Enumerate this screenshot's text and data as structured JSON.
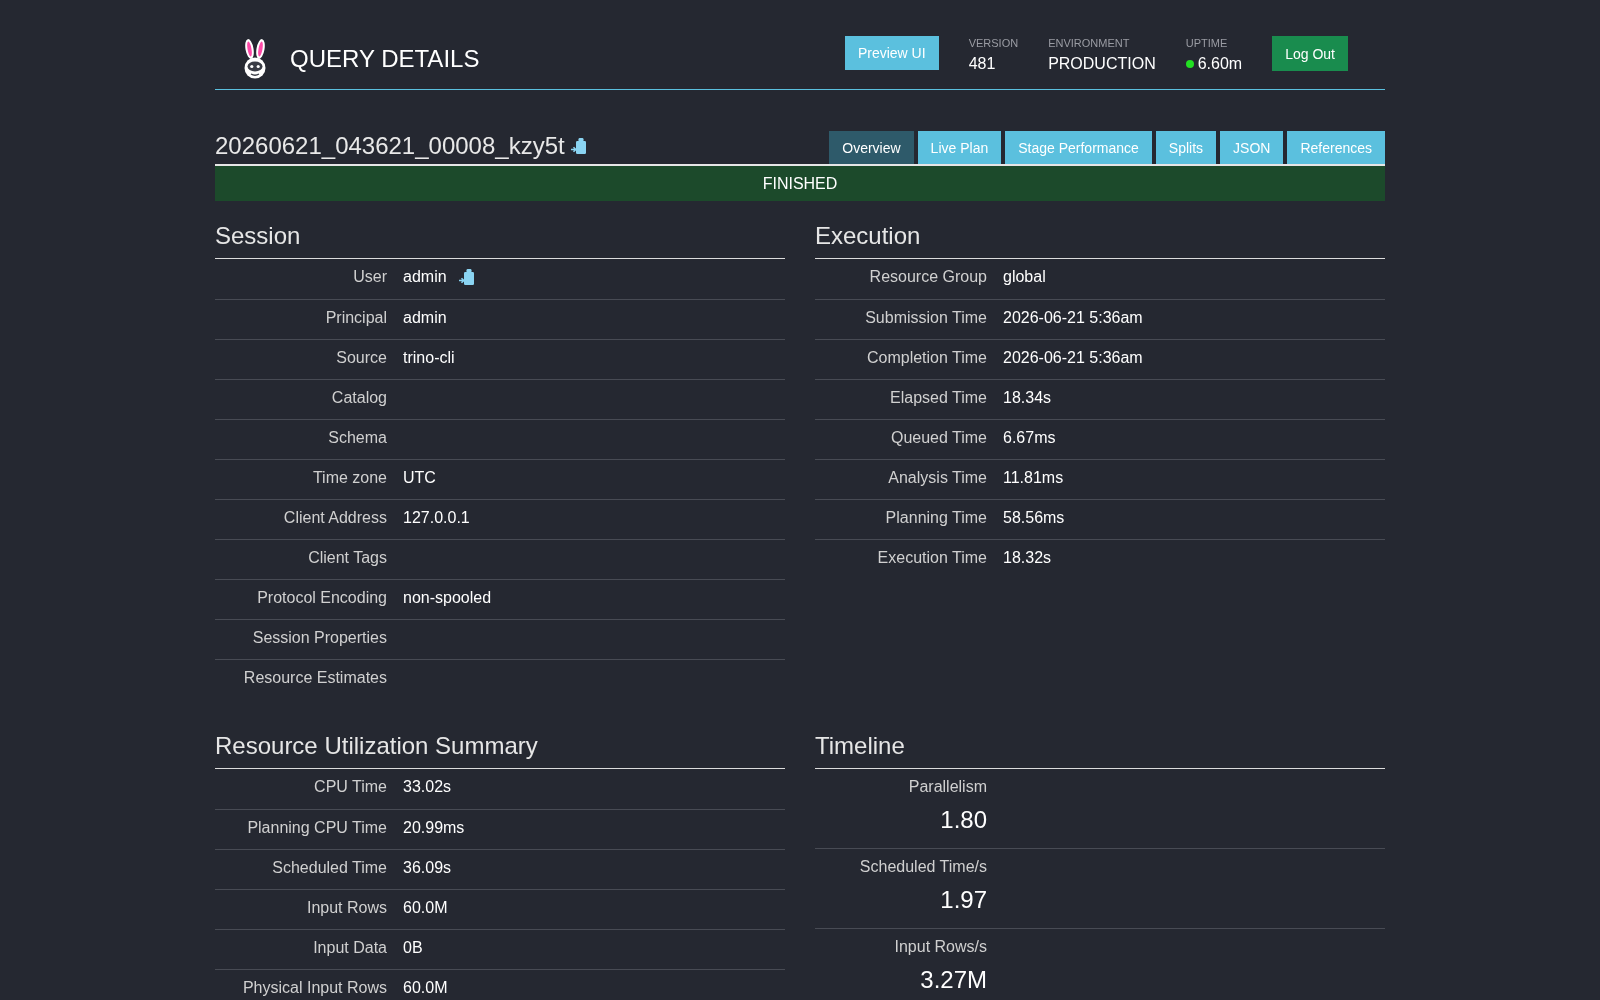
{
  "header": {
    "title": "QUERY DETAILS",
    "preview_button": "Preview UI",
    "stats": [
      {
        "label": "VERSION",
        "value": "481",
        "kind": "plain"
      },
      {
        "label": "ENVIRONMENT",
        "value": "PRODUCTION",
        "kind": "plain"
      },
      {
        "label": "UPTIME",
        "value": "6.60m",
        "kind": "status"
      }
    ],
    "logout_button": "Log Out"
  },
  "query": {
    "id": "20260621_043621_00008_kzy5t"
  },
  "tabs": [
    {
      "label": "Overview",
      "selected": true
    },
    {
      "label": "Live Plan",
      "selected": false
    },
    {
      "label": "Stage Performance",
      "selected": false
    },
    {
      "label": "Splits",
      "selected": false
    },
    {
      "label": "JSON",
      "selected": false
    },
    {
      "label": "References",
      "selected": false
    }
  ],
  "status_banner": {
    "label": "FINISHED"
  },
  "sections": [
    {
      "title": "Session",
      "kind": "table",
      "rows": [
        {
          "label": "User",
          "value": "admin",
          "copyable": true
        },
        {
          "label": "Principal",
          "value": "admin",
          "copyable": false
        },
        {
          "label": "Source",
          "value": "trino-cli",
          "copyable": false
        },
        {
          "label": "Catalog",
          "copyable": false
        },
        {
          "label": "Schema",
          "copyable": false
        },
        {
          "label": "Time zone",
          "value": "UTC",
          "copyable": false
        },
        {
          "label": "Client Address",
          "value": "127.0.0.1",
          "copyable": false
        },
        {
          "label": "Client Tags",
          "copyable": false
        },
        {
          "label": "Protocol Encoding",
          "value": "non-spooled",
          "copyable": false
        },
        {
          "label": "Session Properties",
          "copyable": false
        },
        {
          "label": "Resource Estimates",
          "copyable": false
        }
      ]
    },
    {
      "title": "Execution",
      "kind": "table",
      "rows": [
        {
          "label": "Resource Group",
          "value": "global"
        },
        {
          "label": "Submission Time",
          "value": "2026-06-21 5:36am"
        },
        {
          "label": "Completion Time",
          "value": "2026-06-21 5:36am"
        },
        {
          "label": "Elapsed Time",
          "value": "18.34s"
        },
        {
          "label": "Queued Time",
          "value": "6.67ms"
        },
        {
          "label": "Analysis Time",
          "value": "11.81ms"
        },
        {
          "label": "Planning Time",
          "value": "58.56ms"
        },
        {
          "label": "Execution Time",
          "value": "18.32s"
        }
      ]
    },
    {
      "title": "Resource Utilization Summary",
      "kind": "table",
      "rows": [
        {
          "label": "CPU Time",
          "value": "33.02s"
        },
        {
          "label": "Planning CPU Time",
          "value": "20.99ms"
        },
        {
          "label": "Scheduled Time",
          "value": "36.09s"
        },
        {
          "label": "Input Rows",
          "value": "60.0M"
        },
        {
          "label": "Input Data",
          "value": "0B"
        },
        {
          "label": "Physical Input Rows",
          "value": "60.0M"
        }
      ]
    },
    {
      "title": "Timeline",
      "kind": "metrics",
      "rows": [
        {
          "label": "Parallelism",
          "value": "1.80"
        },
        {
          "label": "Scheduled Time/s",
          "value": "1.97"
        },
        {
          "label": "Input Rows/s",
          "value": "3.27M"
        }
      ]
    }
  ]
}
